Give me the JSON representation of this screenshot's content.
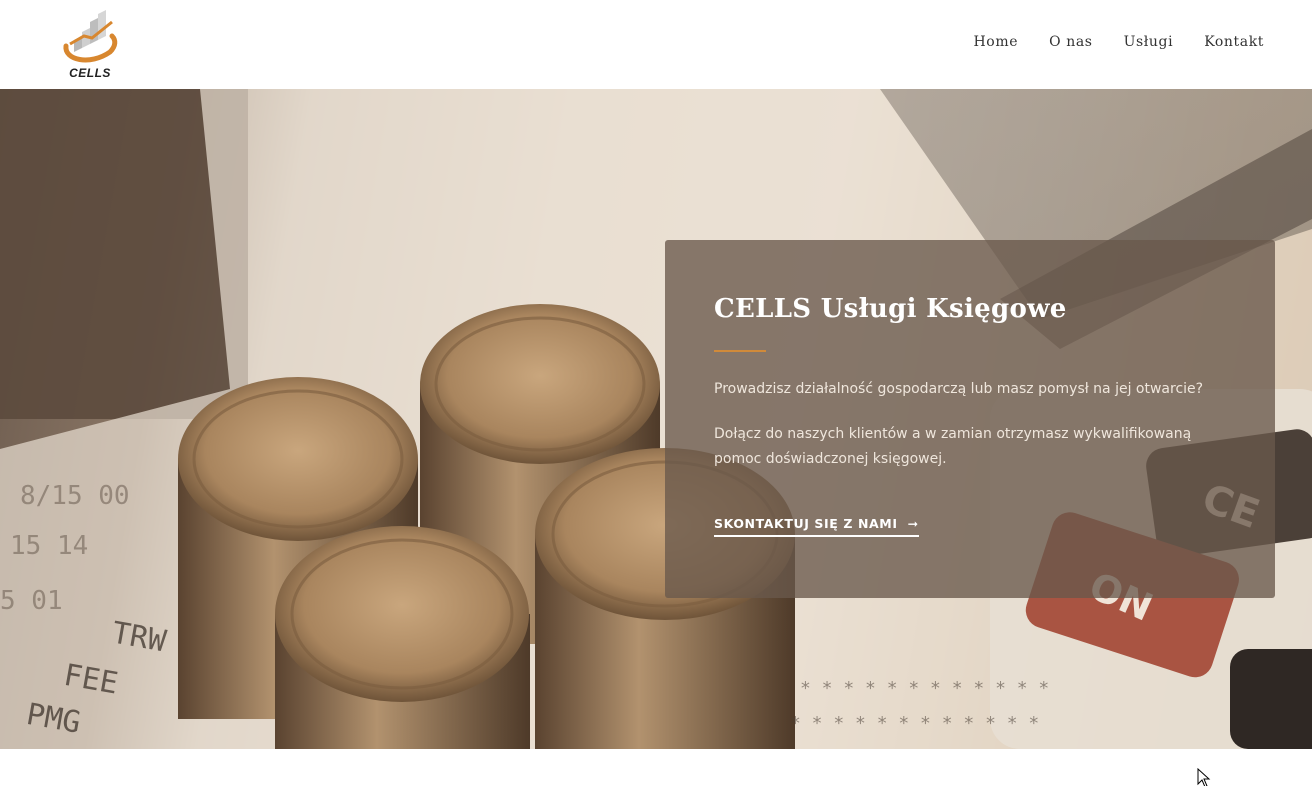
{
  "header": {
    "logo_text": "CELLS",
    "nav": [
      {
        "label": "Home"
      },
      {
        "label": "O nas"
      },
      {
        "label": "Usługi"
      },
      {
        "label": "Kontakt"
      }
    ]
  },
  "hero": {
    "title": "CELLS Usługi Księgowe",
    "paragraph_1": "Prowadzisz działalność gospodarczą lub masz pomysł na jej otwarcie?",
    "paragraph_2": "Dołącz do naszych klientów a w zamian otrzymasz wykwalifikowaną pomoc doświadczonej księgowej.",
    "cta_label": "SKONTAKTUJ SIĘ Z NAMI",
    "cta_icon": "arrow-right-icon",
    "background_image_texts": [
      "TRW",
      "FEE",
      "PMG",
      "CE",
      "ON"
    ]
  },
  "colors": {
    "accent": "#d08a3a",
    "card_bg": "rgba(105,88,75,0.78)",
    "nav_text": "#333333"
  }
}
